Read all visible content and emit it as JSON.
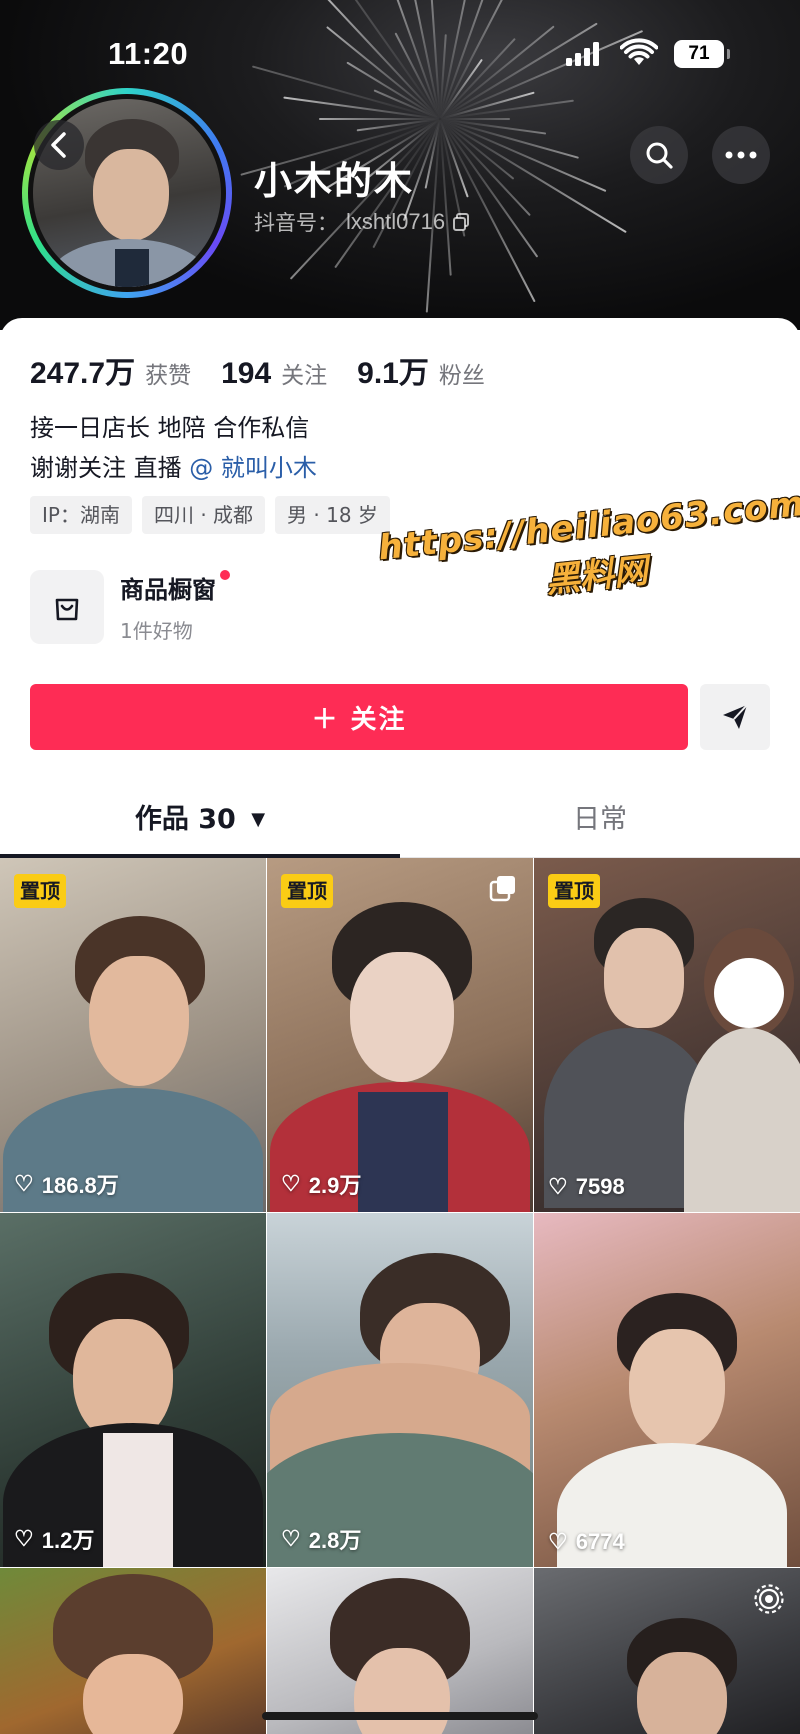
{
  "status_bar": {
    "time": "11:20",
    "battery": "71"
  },
  "profile": {
    "nickname": "小木的木",
    "douyin_id_label": "抖音号：",
    "douyin_id": "lxshtl0716"
  },
  "stats": [
    {
      "num": "247.7万",
      "label": "获赞"
    },
    {
      "num": "194",
      "label": "关注"
    },
    {
      "num": "9.1万",
      "label": "粉丝"
    }
  ],
  "bio": {
    "line1": "接一日店长 地陪 合作私信",
    "line2_prefix": "谢谢关注 直播 ",
    "line2_mention": "@ 就叫小木"
  },
  "tags": [
    "IP：湖南",
    "四川 · 成都",
    "男 · 18 岁"
  ],
  "shop": {
    "title": "商品橱窗",
    "subtitle": "1件好物"
  },
  "watermark": {
    "url": "https://heiliao63.com",
    "name": "黑料网"
  },
  "follow_label": "＋ 关注",
  "tabs": {
    "works": "作品 30",
    "daily": "日常"
  },
  "videos": [
    {
      "pinned_label": "置顶",
      "likes": "186.8万"
    },
    {
      "pinned_label": "置顶",
      "likes": "2.9万"
    },
    {
      "pinned_label": "置顶",
      "likes": "7598"
    },
    {
      "pinned_label": "",
      "likes": "1.2万"
    },
    {
      "pinned_label": "",
      "likes": "2.8万"
    },
    {
      "pinned_label": "",
      "likes": "6774"
    },
    {
      "pinned_label": "",
      "likes": ""
    },
    {
      "pinned_label": "",
      "likes": ""
    },
    {
      "pinned_label": "",
      "likes": ""
    }
  ],
  "colors": {
    "accent": "#fe2c55",
    "pin": "#facc15",
    "mention": "#2a5ea8"
  }
}
